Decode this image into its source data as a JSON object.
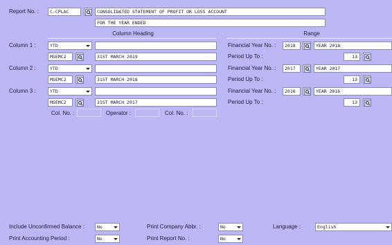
{
  "report": {
    "label": "Report No. :",
    "code": "C-CPLAC",
    "title_line1": "CONSOLIDATED STATEMENT OF PROFIT OR LOSS ACCOUNT",
    "title_line2": "FOR THE YEAR ENDED"
  },
  "headers": {
    "column_heading": "Column Heading",
    "range": "Range"
  },
  "columns": [
    {
      "label": "Column 1 :",
      "type": "YTD",
      "heading_text": "",
      "code": "MSEMC2",
      "description": "31ST MARCH 2019",
      "fy_label": "Financial Year No. :",
      "fy_no": "2018",
      "fy_name": "YEAR 2018",
      "period_label": "Period Up To :",
      "period": "13"
    },
    {
      "label": "Column 2 :",
      "type": "YTD",
      "heading_text": "",
      "code": "MSEMC2",
      "description": "31ST MARCH 2018",
      "fy_label": "Financial Year No. :",
      "fy_no": "2017",
      "fy_name": "YEAR 2017",
      "period_label": "Period Up To :",
      "period": "13"
    },
    {
      "label": "Column 3 :",
      "type": "YTD",
      "heading_text": "",
      "code": "MSEMC2",
      "description": "31ST MARCH 2017",
      "fy_label": "Financial Year No. :",
      "fy_no": "2016",
      "fy_name": "YEAR 2016",
      "period_label": "Period Up To :",
      "period": "13"
    }
  ],
  "calc": {
    "col_no_label": "Col. No. :",
    "operator_label": "Operator :",
    "col_no2_label": "Col. No. :"
  },
  "options": {
    "unconfirmed_label": "Include Unconfirmed Balance :",
    "unconfirmed_value": "No",
    "accounting_period_label": "Print Accounting Period :",
    "accounting_period_value": "No",
    "company_abbr_label": "Print Company Abbr. :",
    "company_abbr_value": "No",
    "report_no_label": "Print Report No. :",
    "report_no_value": "No",
    "language_label": "Language :",
    "language_value": "English"
  },
  "colors": {
    "background": "#bcb8f6",
    "field_bg": "#ffffff",
    "border": "#8a88b8"
  }
}
